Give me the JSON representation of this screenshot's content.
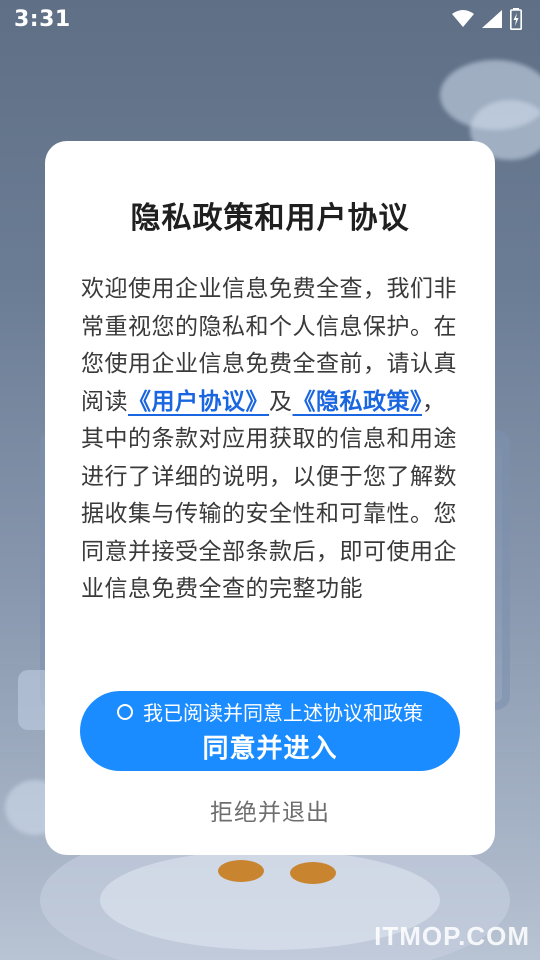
{
  "status_bar": {
    "time": "3:31",
    "icons": [
      "wifi-icon",
      "signal-icon",
      "battery-charging-icon"
    ]
  },
  "dialog": {
    "title": "隐私政策和用户协议",
    "body": {
      "part1": "欢迎使用企业信息免费全查，我们非常重视您的隐私和个人信息保护。在您使用企业信息免费全查前，请认真阅读",
      "user_agreement_link": "《用户协议》",
      "and": "及",
      "privacy_policy_link": "《隐私政策》",
      "part2": "，  其中的条款对应用获取的信息和用途进行了详细的说明，以便于您了解数据收集与传输的安全性和可靠性。您同意并接受全部条款后，即可使用企业信息免费全查的完整功能"
    },
    "agree_checkbox_label": "我已阅读并同意上述协议和政策",
    "agree_button_label": "同意并进入",
    "reject_button_label": "拒绝并退出"
  },
  "watermark": "ITMOP.COM",
  "colors": {
    "accent": "#1a8cff",
    "link": "#1a66e0",
    "dialog_bg": "#ffffff"
  }
}
